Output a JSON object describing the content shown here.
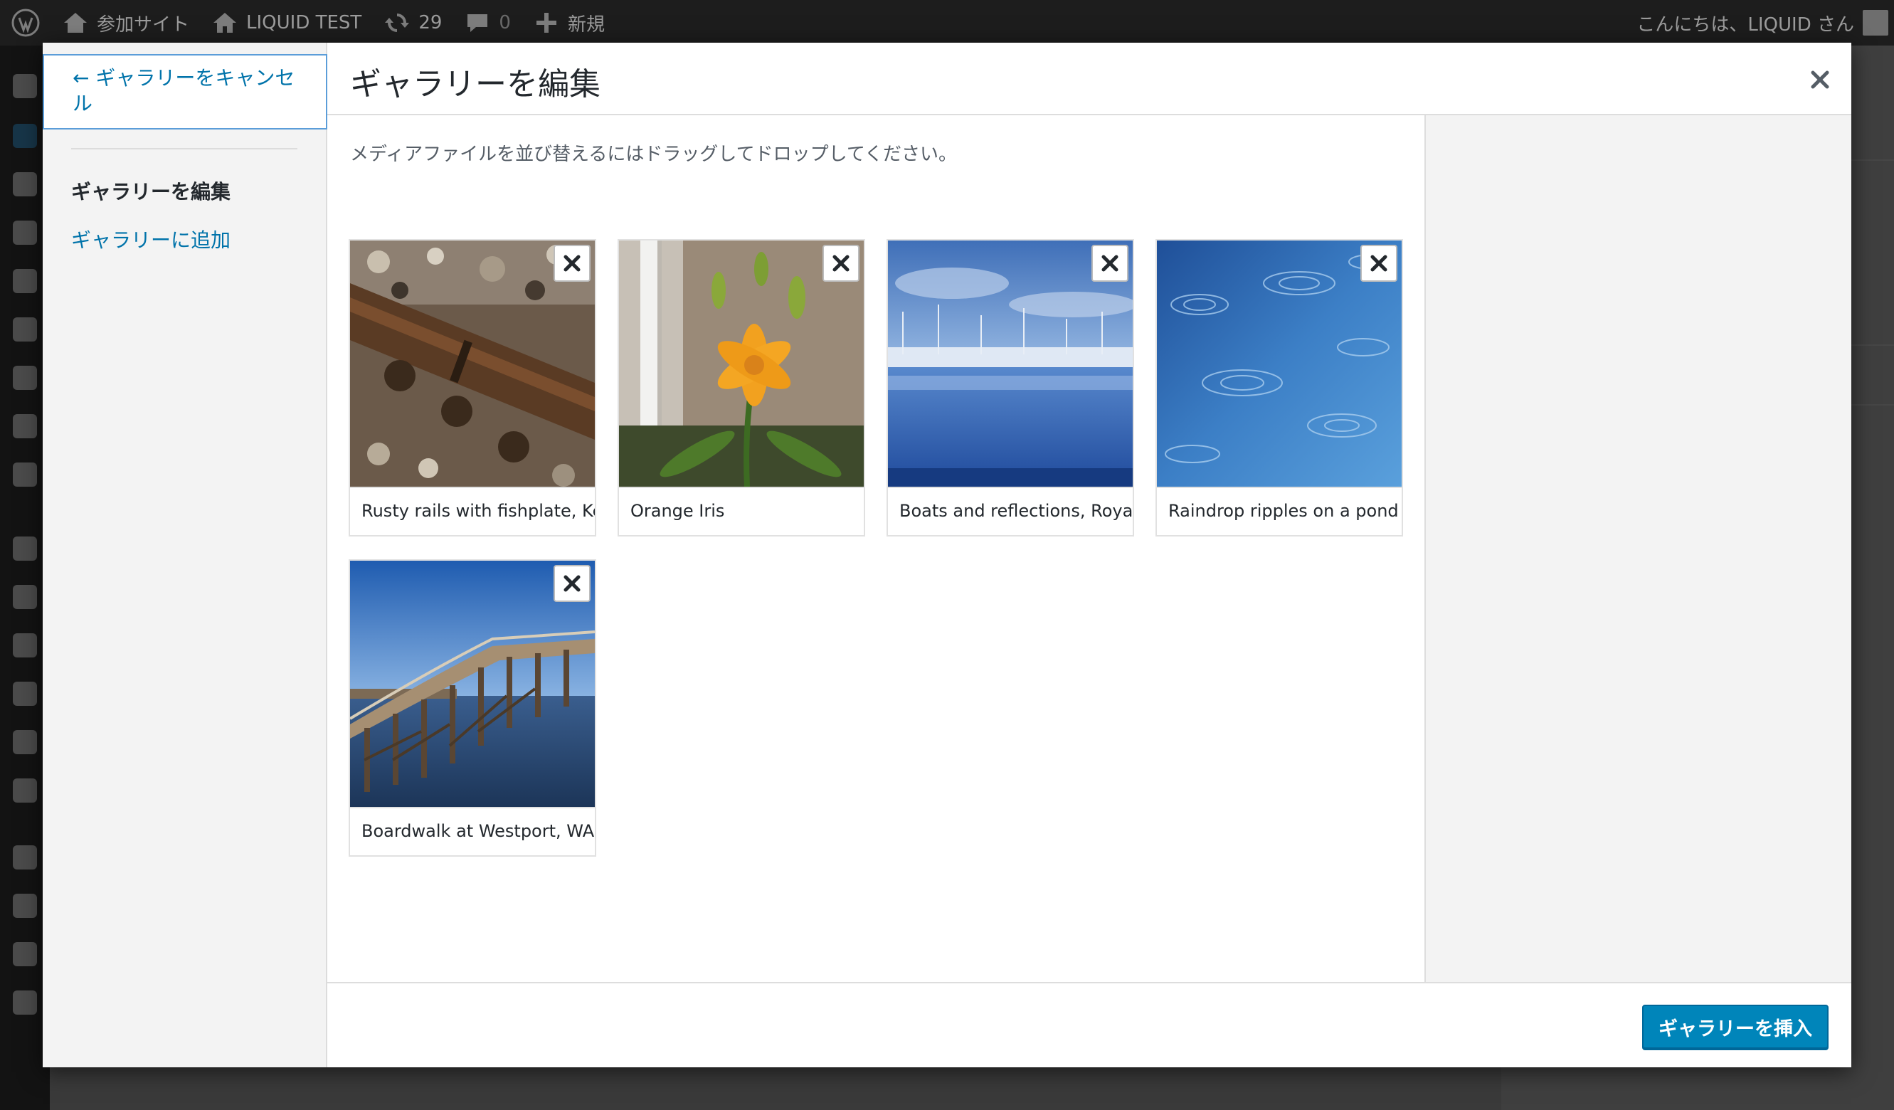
{
  "adminbar": {
    "site_label": "参加サイト",
    "site_name": "LIQUID TEST",
    "updates_count": "29",
    "comments_count": "0",
    "new_label": "新規",
    "greeting": "こんにちは、LIQUID さん"
  },
  "menu": {
    "cancel_label": "← ギャラリーをキャンセル",
    "edit_label": "ギャラリーを編集",
    "add_label": "ギャラリーに追加"
  },
  "header": {
    "title": "ギャラリーを編集"
  },
  "content": {
    "instructions": "メディアファイルを並び替えるにはドラッグしてドロップしてください。"
  },
  "attachments": [
    {
      "caption": "Rusty rails with fishplate, Kel",
      "image": "rusty-rails"
    },
    {
      "caption": "Orange Iris",
      "image": "orange-iris"
    },
    {
      "caption": "Boats and reflections, Royal",
      "image": "boats-reflections"
    },
    {
      "caption": "Raindrop ripples on a pond",
      "image": "raindrop-ripples"
    },
    {
      "caption": "Boardwalk at Westport, WA",
      "image": "boardwalk"
    }
  ],
  "toolbar": {
    "insert_label": "ギャラリーを挿入"
  },
  "colors": {
    "accent": "#0073aa",
    "primary_button": "#0085ba",
    "adminbar_bg": "#1d1d1d"
  },
  "icons": {
    "wp_logo": "wordpress-icon",
    "site": "sites-icon",
    "home": "home-icon",
    "updates": "refresh-icon",
    "comments": "comment-icon",
    "new": "plus-icon",
    "close": "close-icon",
    "remove": "remove-icon"
  }
}
